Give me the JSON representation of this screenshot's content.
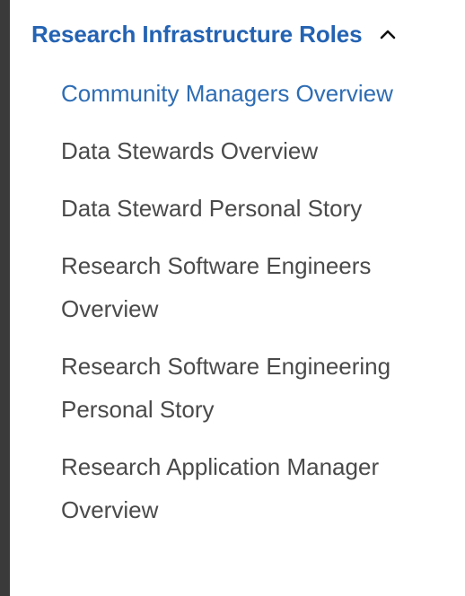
{
  "section": {
    "title": "Research Infrastructure Roles",
    "toggle_icon": "chevron-up-icon",
    "expanded": true
  },
  "colors": {
    "accent": "#2463b3",
    "text": "#4a4a4a",
    "frame": "#3a3a3a"
  },
  "items": [
    {
      "label": "Community Managers Overview",
      "active": true
    },
    {
      "label": "Data Stewards Overview",
      "active": false
    },
    {
      "label": "Data Steward Personal Story",
      "active": false
    },
    {
      "label": "Research Software Engineers Overview",
      "active": false
    },
    {
      "label": "Research Software Engineering Personal Story",
      "active": false
    },
    {
      "label": "Research Application Manager Overview",
      "active": false
    }
  ]
}
